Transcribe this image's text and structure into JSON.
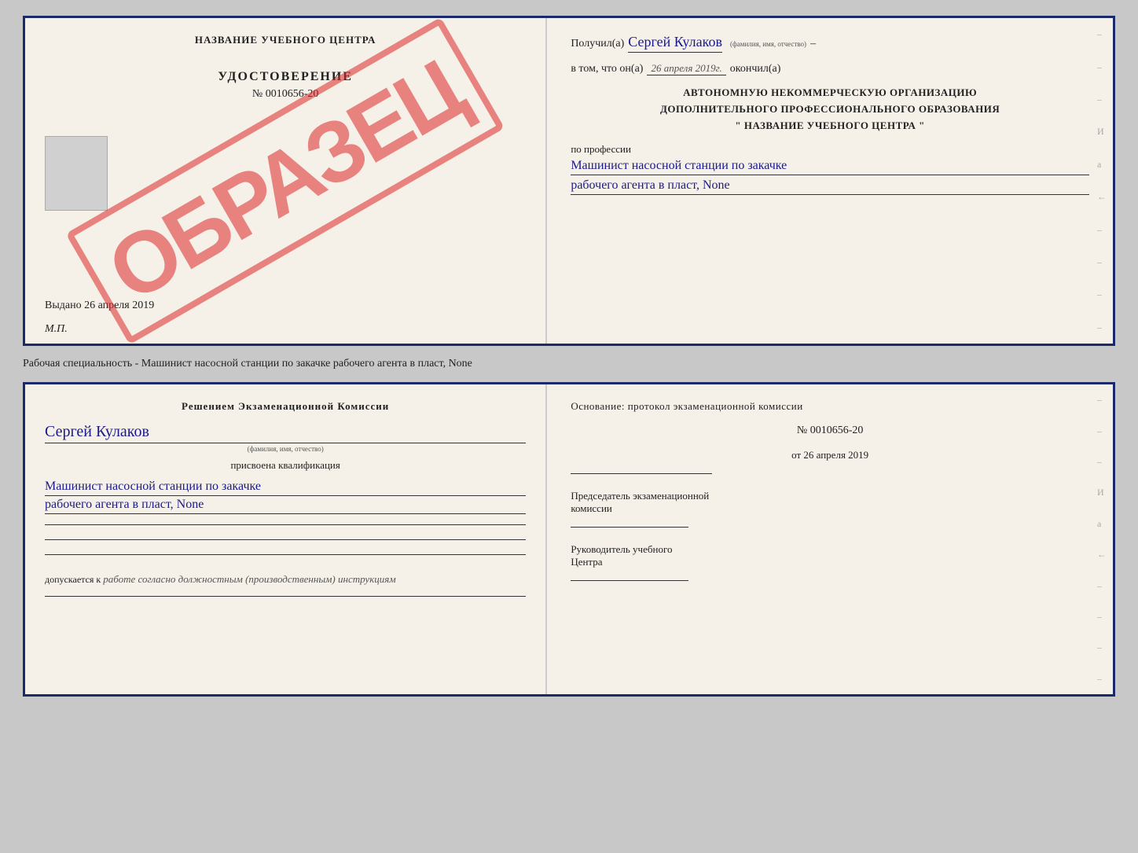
{
  "top_doc": {
    "left": {
      "center_title": "НАЗВАНИЕ УЧЕБНОГО ЦЕНТРА",
      "stamp": "ОБРАЗЕЦ",
      "udostoverenie": "УДОСТОВЕРЕНИЕ",
      "nomer": "№ 0010656-20",
      "vydano": "Выдано 26 апреля 2019",
      "mp": "М.П."
    },
    "right": {
      "poluchil_prefix": "Получил(а)",
      "poluchil_name": "Сергей Кулаков",
      "fio_hint": "(фамилия, имя, отчество)",
      "vtom_prefix": "в том, что он(а)",
      "vtom_date": "26 апреля 2019г.",
      "okoncil": "окончил(а)",
      "avto_line1": "АВТОНОМНУЮ НЕКОММЕРЧЕСКУЮ ОРГАНИЗАЦИЮ",
      "avto_line2": "ДОПОЛНИТЕЛЬНОГО ПРОФЕССИОНАЛЬНОГО ОБРАЗОВАНИЯ",
      "avto_line3": "\"   НАЗВАНИЕ УЧЕБНОГО ЦЕНТРА   \"",
      "po_professii": "по профессии",
      "profession_line1": "Машинист насосной станции по закачке",
      "profession_line2": "рабочего агента в пласт, None"
    }
  },
  "middle_label": "Рабочая специальность - Машинист насосной станции по закачке рабочего агента в пласт, None",
  "bottom_doc": {
    "left": {
      "reshenie_title": "Решением экзаменационной комиссии",
      "name": "Сергей Кулаков",
      "fio_hint": "(фамилия, имя, отчество)",
      "prisvoena": "присвоена квалификация",
      "qual_line1": "Машинист насосной станции по закачке",
      "qual_line2": "рабочего агента в пласт, None",
      "dopuskaetsya": "допускается к",
      "dopusk_text": "работе согласно должностным (производственным) инструкциям"
    },
    "right": {
      "osnovanie": "Основание: протокол экзаменационной комиссии",
      "nomer": "№ 0010656-20",
      "ot_label": "от",
      "ot_date": "26 апреля 2019",
      "predsedatel_line1": "Председатель экзаменационной",
      "predsedatel_line2": "комиссии",
      "rukovoditel_line1": "Руководитель учебного",
      "rukovoditel_line2": "Центра"
    }
  },
  "side_chars": [
    "–",
    "–",
    "–",
    "И",
    "а",
    "←",
    "–",
    "–",
    "–",
    "–"
  ],
  "side_chars2": [
    "–",
    "–",
    "–",
    "И",
    "а",
    "←",
    "–",
    "–",
    "–",
    "–"
  ]
}
